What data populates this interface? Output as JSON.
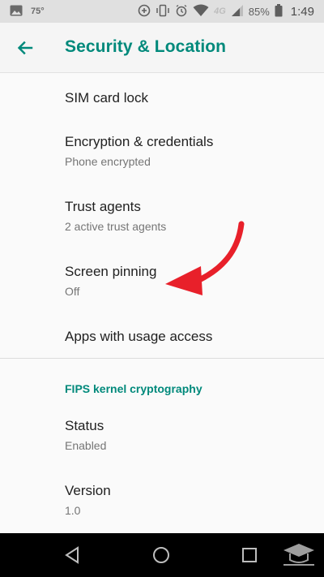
{
  "status_bar": {
    "temperature": "75°",
    "network": "4G",
    "battery_percent": "85%",
    "time": "1:49",
    "icons": [
      "image-icon",
      "data-saver-icon",
      "vibrate-icon",
      "alarm-icon",
      "wifi-icon",
      "signal-icon",
      "battery-icon"
    ]
  },
  "header": {
    "title": "Security & Location",
    "back_icon": "arrow-back-icon"
  },
  "items": [
    {
      "title": "SIM card lock",
      "summary": ""
    },
    {
      "title": "Encryption & credentials",
      "summary": "Phone encrypted"
    },
    {
      "title": "Trust agents",
      "summary": "2 active trust agents"
    },
    {
      "title": "Screen pinning",
      "summary": "Off"
    },
    {
      "title": "Apps with usage access",
      "summary": ""
    }
  ],
  "fips": {
    "header": "FIPS kernel cryptography",
    "items": [
      {
        "title": "Status",
        "summary": "Enabled"
      },
      {
        "title": "Version",
        "summary": "1.0"
      }
    ]
  },
  "nav_bar": {
    "icons": [
      "back-triangle-icon",
      "home-circle-icon",
      "recents-square-icon"
    ]
  },
  "colors": {
    "accent": "#00897b",
    "annotation_arrow": "#e8202a"
  }
}
